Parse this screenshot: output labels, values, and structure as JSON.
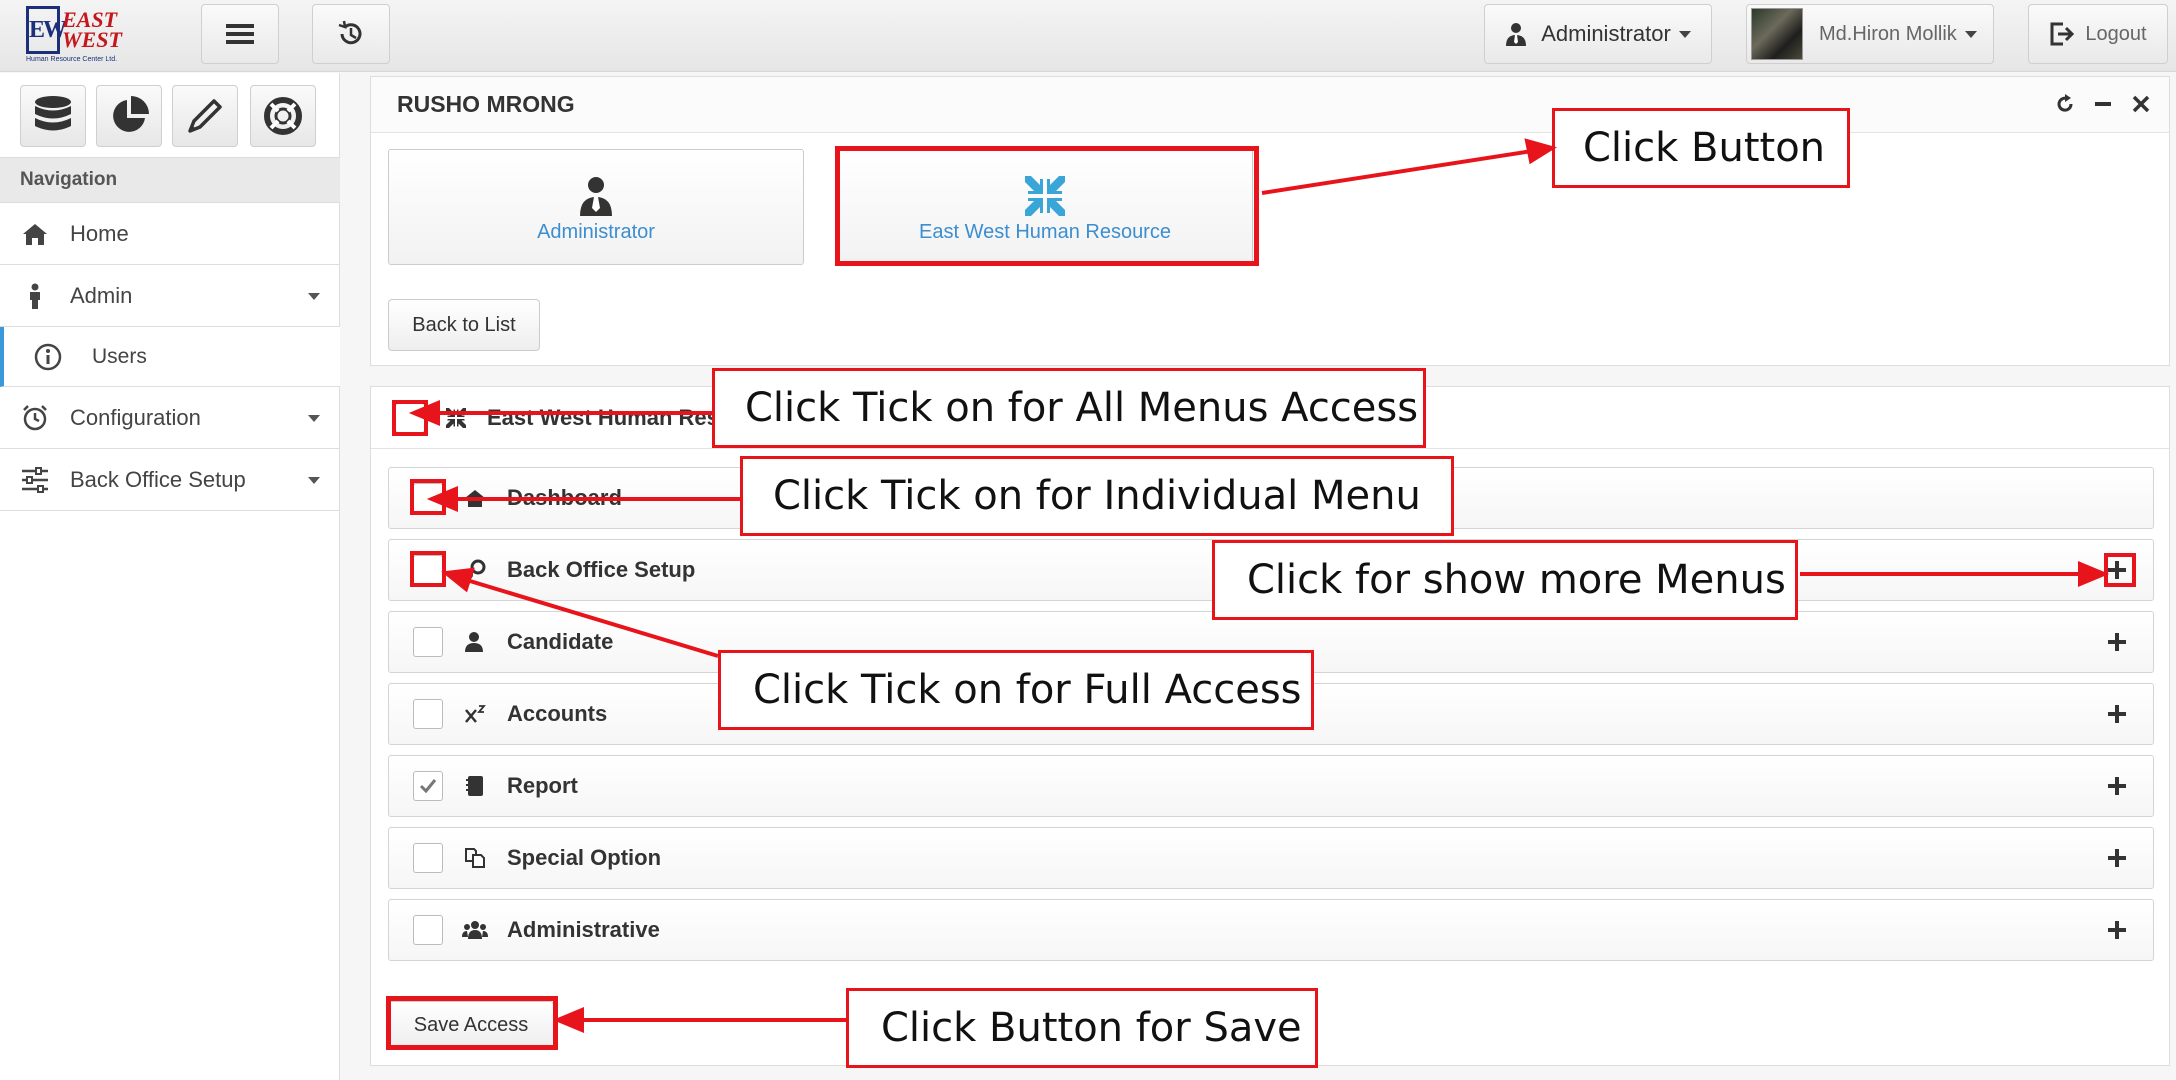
{
  "topbar": {
    "logo_mark": "EW",
    "logo_line1": "EAST",
    "logo_line2": "WEST",
    "logo_sub": "Human Resource Center Ltd.",
    "role_label": "Administrator",
    "user_label": "Md.Hiron Mollik",
    "logout_label": "Logout"
  },
  "sidebar": {
    "nav_header": "Navigation",
    "items": [
      {
        "label": "Home",
        "icon": "home-icon"
      },
      {
        "label": "Admin",
        "icon": "person-icon"
      },
      {
        "label": "Users",
        "icon": "info-icon"
      },
      {
        "label": "Configuration",
        "icon": "alarm-clock-icon"
      },
      {
        "label": "Back Office Setup",
        "icon": "sliders-icon"
      }
    ]
  },
  "panel": {
    "title": "RUSHO MRONG",
    "tiles": [
      {
        "label": "Administrator",
        "icon": "user-tie-icon"
      },
      {
        "label": "East West Human Resource",
        "icon": "compress-icon"
      }
    ],
    "back_label": "Back to List"
  },
  "access": {
    "root_label": "East West Human Resource",
    "rows": [
      {
        "label": "Dashboard",
        "checked": false
      },
      {
        "label": "Back Office Setup",
        "checked": false
      },
      {
        "label": "Candidate",
        "checked": false
      },
      {
        "label": "Accounts",
        "checked": false
      },
      {
        "label": "Report",
        "checked": true
      },
      {
        "label": "Special Option",
        "checked": false
      },
      {
        "label": "Administrative",
        "checked": false
      }
    ],
    "save_label": "Save Access"
  },
  "annotations": {
    "click_button": "Click Button",
    "all_menus": "Click Tick on for All Menus Access",
    "individual": "Click Tick on for Individual Menu",
    "show_more": "Click for show more Menus",
    "full_access": "Click Tick on for Full Access",
    "save": "Click Button for Save"
  },
  "colors": {
    "annotation_red": "#e8141b",
    "link_blue": "#3b8ed0",
    "tile_icon_blue": "#3aa6d8"
  }
}
